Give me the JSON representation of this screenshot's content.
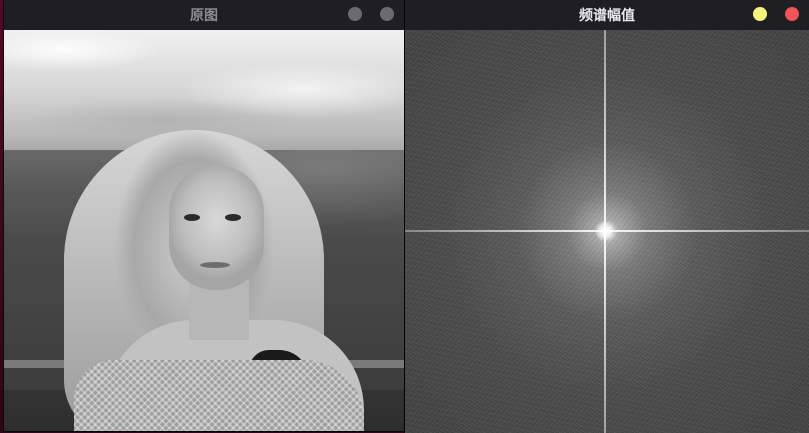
{
  "windows": {
    "original": {
      "title": "原图",
      "controls": [
        {
          "name": "minimize",
          "color": "#6b6b70"
        },
        {
          "name": "close",
          "color": "#6b6b70"
        }
      ]
    },
    "spectrum": {
      "title": "频谱幅值",
      "controls": [
        {
          "name": "minimize",
          "color": "#f4f47a"
        },
        {
          "name": "close",
          "color": "#f25555"
        }
      ]
    }
  },
  "colors": {
    "titlebar": "#1f1f23",
    "desktop": "#3a0a1e"
  }
}
